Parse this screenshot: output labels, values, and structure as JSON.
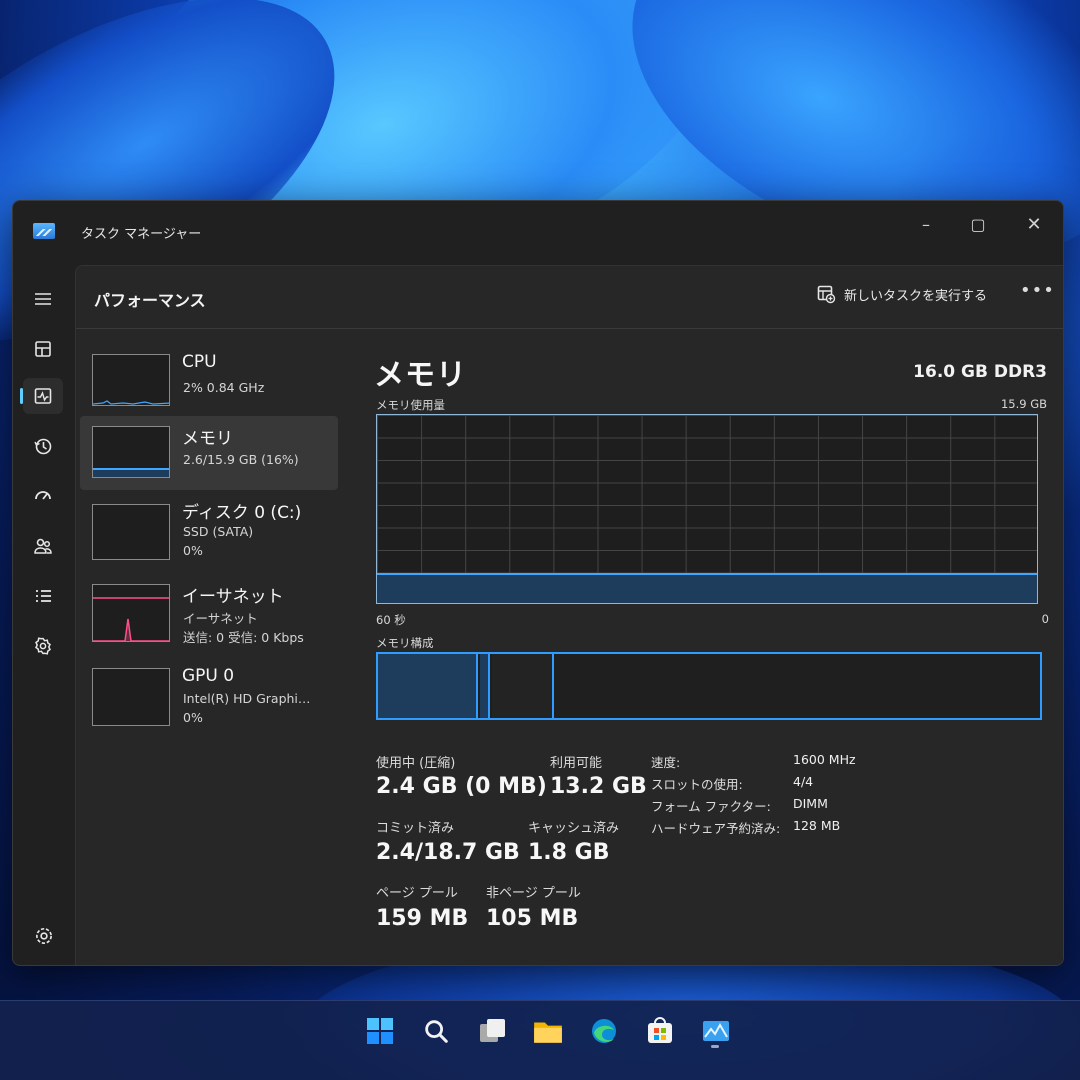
{
  "window": {
    "app_title": "タスク マネージャー",
    "controls": {
      "minimize": "–",
      "maximize": "▢",
      "close": "✕"
    }
  },
  "header": {
    "page_title": "パフォーマンス",
    "run_task_label": "新しいタスクを実行する",
    "more_label": "•••"
  },
  "nav": {
    "items": [
      {
        "icon": "hamburger-menu-icon"
      },
      {
        "icon": "processes-icon"
      },
      {
        "icon": "performance-icon",
        "active": true
      },
      {
        "icon": "app-history-icon"
      },
      {
        "icon": "startup-apps-icon"
      },
      {
        "icon": "users-icon"
      },
      {
        "icon": "details-icon"
      },
      {
        "icon": "services-icon"
      },
      {
        "icon": "settings-icon"
      }
    ]
  },
  "resources": [
    {
      "name": "CPU",
      "lines": [
        "2%  0.84 GHz"
      ]
    },
    {
      "name": "メモリ",
      "lines": [
        "2.6/15.9 GB (16%)"
      ],
      "selected": true
    },
    {
      "name": "ディスク 0 (C:)",
      "lines": [
        "SSD (SATA)",
        "0%"
      ]
    },
    {
      "name": "イーサネット",
      "lines": [
        "イーサネット",
        "送信: 0  受信: 0 Kbps"
      ]
    },
    {
      "name": "GPU 0",
      "lines": [
        "Intel(R) HD Graphi…",
        "0%"
      ]
    }
  ],
  "detail": {
    "title": "メモリ",
    "spec": "16.0 GB DDR3",
    "usage_label": "メモリ使用量",
    "usage_max": "15.9 GB",
    "time_left": "60 秒",
    "time_right": "0",
    "usage_fraction": 0.16,
    "composition_label": "メモリ構成",
    "stats": {
      "in_use_label": "使用中 (圧縮)",
      "in_use_value": "2.4 GB (0 MB)",
      "available_label": "利用可能",
      "available_value": "13.2 GB",
      "committed_label": "コミット済み",
      "committed_value": "2.4/18.7 GB",
      "cached_label": "キャッシュ済み",
      "cached_value": "1.8 GB",
      "paged_label": "ページ プール",
      "paged_value": "159 MB",
      "nonpaged_label": "非ページ プール",
      "nonpaged_value": "105 MB"
    },
    "props": [
      {
        "key": "速度:",
        "value": "1600 MHz"
      },
      {
        "key": "スロットの使用:",
        "value": "4/4"
      },
      {
        "key": "フォーム ファクター:",
        "value": "DIMM"
      },
      {
        "key": "ハードウェア予約済み:",
        "value": "128 MB"
      }
    ]
  },
  "taskbar": {
    "icons": [
      "start-icon",
      "search-icon",
      "task-view-icon",
      "file-explorer-icon",
      "edge-icon",
      "store-icon",
      "task-manager-icon"
    ]
  },
  "colors": {
    "accent": "#60cdff",
    "memory_line": "#3ea7ff",
    "ethernet_line": "#ff4f8b"
  }
}
